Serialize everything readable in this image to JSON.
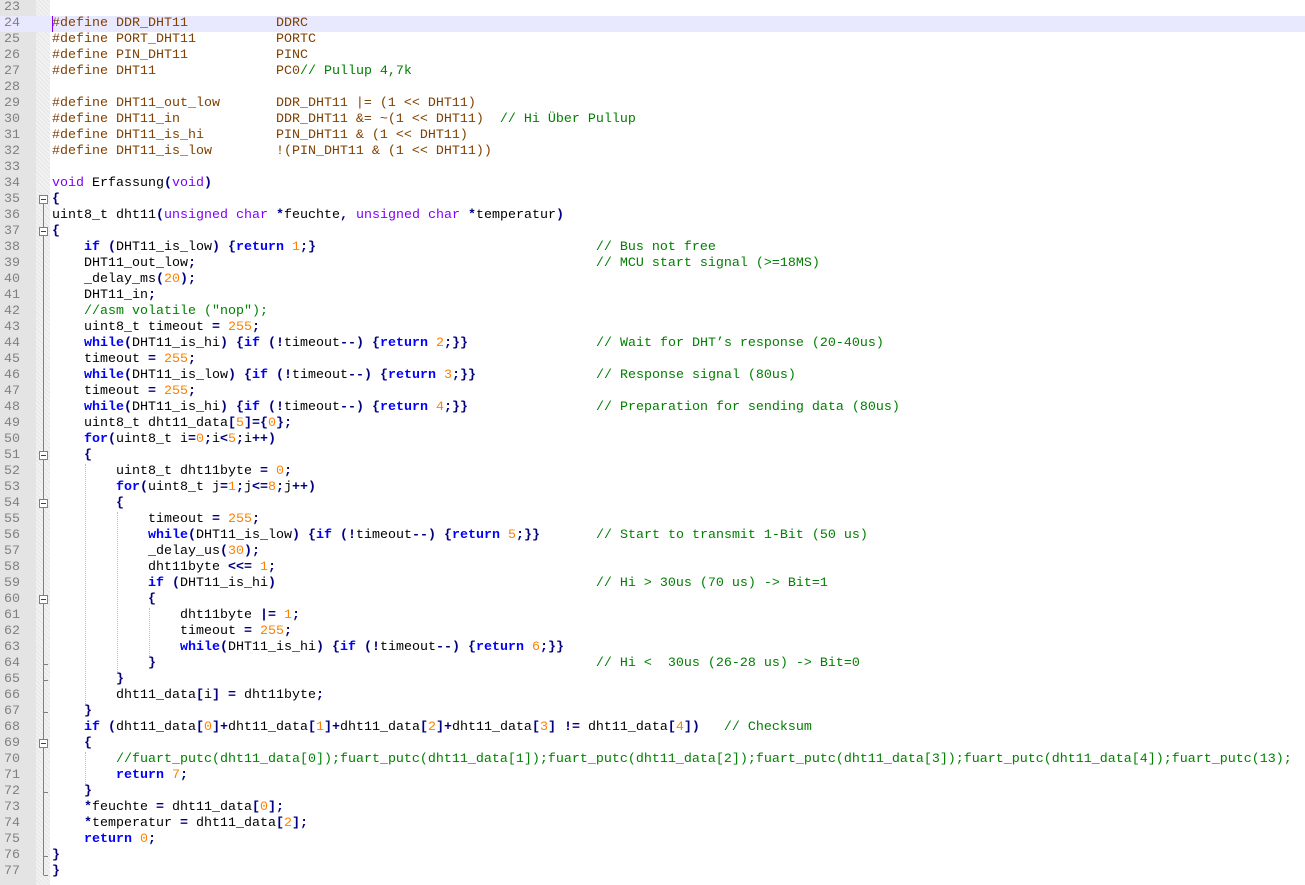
{
  "editor": {
    "first_line_number": 23,
    "current_line": 24,
    "lines": [
      {
        "t": ""
      },
      {
        "d": [
          "#define DDR_DHT11",
          "DDRC"
        ]
      },
      {
        "d": [
          "#define PORT_DHT11",
          "PORTC"
        ]
      },
      {
        "d": [
          "#define PIN_DHT11",
          "PINC"
        ]
      },
      {
        "d": [
          "#define DHT11",
          "PC0// Pullup 4,7k"
        ]
      },
      {
        "t": ""
      },
      {
        "d": [
          "#define DHT11_out_low",
          "DDR_DHT11 |= (1 << DHT11)"
        ]
      },
      {
        "d": [
          "#define DHT11_in",
          "DDR_DHT11 &= ~(1 << DHT11)  // Hi Über Pullup"
        ]
      },
      {
        "d": [
          "#define DHT11_is_hi",
          "PIN_DHT11 & (1 << DHT11)"
        ]
      },
      {
        "d": [
          "#define DHT11_is_low",
          "!(PIN_DHT11 & (1 << DHT11))"
        ]
      },
      {
        "t": ""
      },
      {
        "t": "void Erfassung(void)"
      },
      {
        "t": "{"
      },
      {
        "t": "uint8_t dht11(unsigned char *feuchte, unsigned char *temperatur)"
      },
      {
        "t": "{"
      },
      {
        "a": [
          "    if (DHT11_is_low) {return 1;}",
          "// Bus not free"
        ]
      },
      {
        "a": [
          "    DHT11_out_low;",
          "// MCU start signal (>=18MS)"
        ]
      },
      {
        "t": "    _delay_ms(20);"
      },
      {
        "t": "    DHT11_in;"
      },
      {
        "t": "    //asm volatile (\"nop\");"
      },
      {
        "t": "    uint8_t timeout = 255;"
      },
      {
        "a": [
          "    while(DHT11_is_hi) {if (!timeout--) {return 2;}}",
          "// Wait for DHT’s response (20-40us)"
        ]
      },
      {
        "t": "    timeout = 255;"
      },
      {
        "a": [
          "    while(DHT11_is_low) {if (!timeout--) {return 3;}}",
          "// Response signal (80us)"
        ]
      },
      {
        "t": "    timeout = 255;"
      },
      {
        "a": [
          "    while(DHT11_is_hi) {if (!timeout--) {return 4;}}",
          "// Preparation for sending data (80us)"
        ]
      },
      {
        "t": "    uint8_t dht11_data[5]={0};"
      },
      {
        "t": "    for(uint8_t i=0;i<5;i++)"
      },
      {
        "t": "    {"
      },
      {
        "t": "        uint8_t dht11byte = 0;"
      },
      {
        "t": "        for(uint8_t j=1;j<=8;j++)"
      },
      {
        "t": "        {"
      },
      {
        "t": "            timeout = 255;"
      },
      {
        "a": [
          "            while(DHT11_is_low) {if (!timeout--) {return 5;}}",
          "// Start to transmit 1-Bit (50 us)"
        ]
      },
      {
        "t": "            _delay_us(30);"
      },
      {
        "t": "            dht11byte <<= 1;"
      },
      {
        "a": [
          "            if (DHT11_is_hi)",
          "// Hi > 30us (70 us) -> Bit=1"
        ]
      },
      {
        "t": "            {"
      },
      {
        "t": "                dht11byte |= 1;"
      },
      {
        "t": "                timeout = 255;"
      },
      {
        "t": "                while(DHT11_is_hi) {if (!timeout--) {return 6;}}"
      },
      {
        "a": [
          "            }",
          "// Hi <  30us (26-28 us) -> Bit=0"
        ]
      },
      {
        "t": "        }"
      },
      {
        "t": "        dht11_data[i] = dht11byte;"
      },
      {
        "t": "    }"
      },
      {
        "t": "    if (dht11_data[0]+dht11_data[1]+dht11_data[2]+dht11_data[3] != dht11_data[4])   // Checksum"
      },
      {
        "t": "    {"
      },
      {
        "t": "        //fuart_putc(dht11_data[0]);fuart_putc(dht11_data[1]);fuart_putc(dht11_data[2]);fuart_putc(dht11_data[3]);fuart_putc(dht11_data[4]);fuart_putc(13);"
      },
      {
        "t": "        return 7;"
      },
      {
        "t": "    }"
      },
      {
        "t": "    *feuchte = dht11_data[0];"
      },
      {
        "t": "    *temperatur = dht11_data[2];"
      },
      {
        "t": "    return 0;"
      },
      {
        "t": "}"
      },
      {
        "t": "}"
      }
    ]
  },
  "colors": {
    "preprocessor": "#804000",
    "keyword": "#0000ff",
    "type": "#8000ff",
    "number": "#ff8000",
    "comment": "#008000",
    "operator": "#000080",
    "current_line_bg": "#e8e8ff"
  }
}
